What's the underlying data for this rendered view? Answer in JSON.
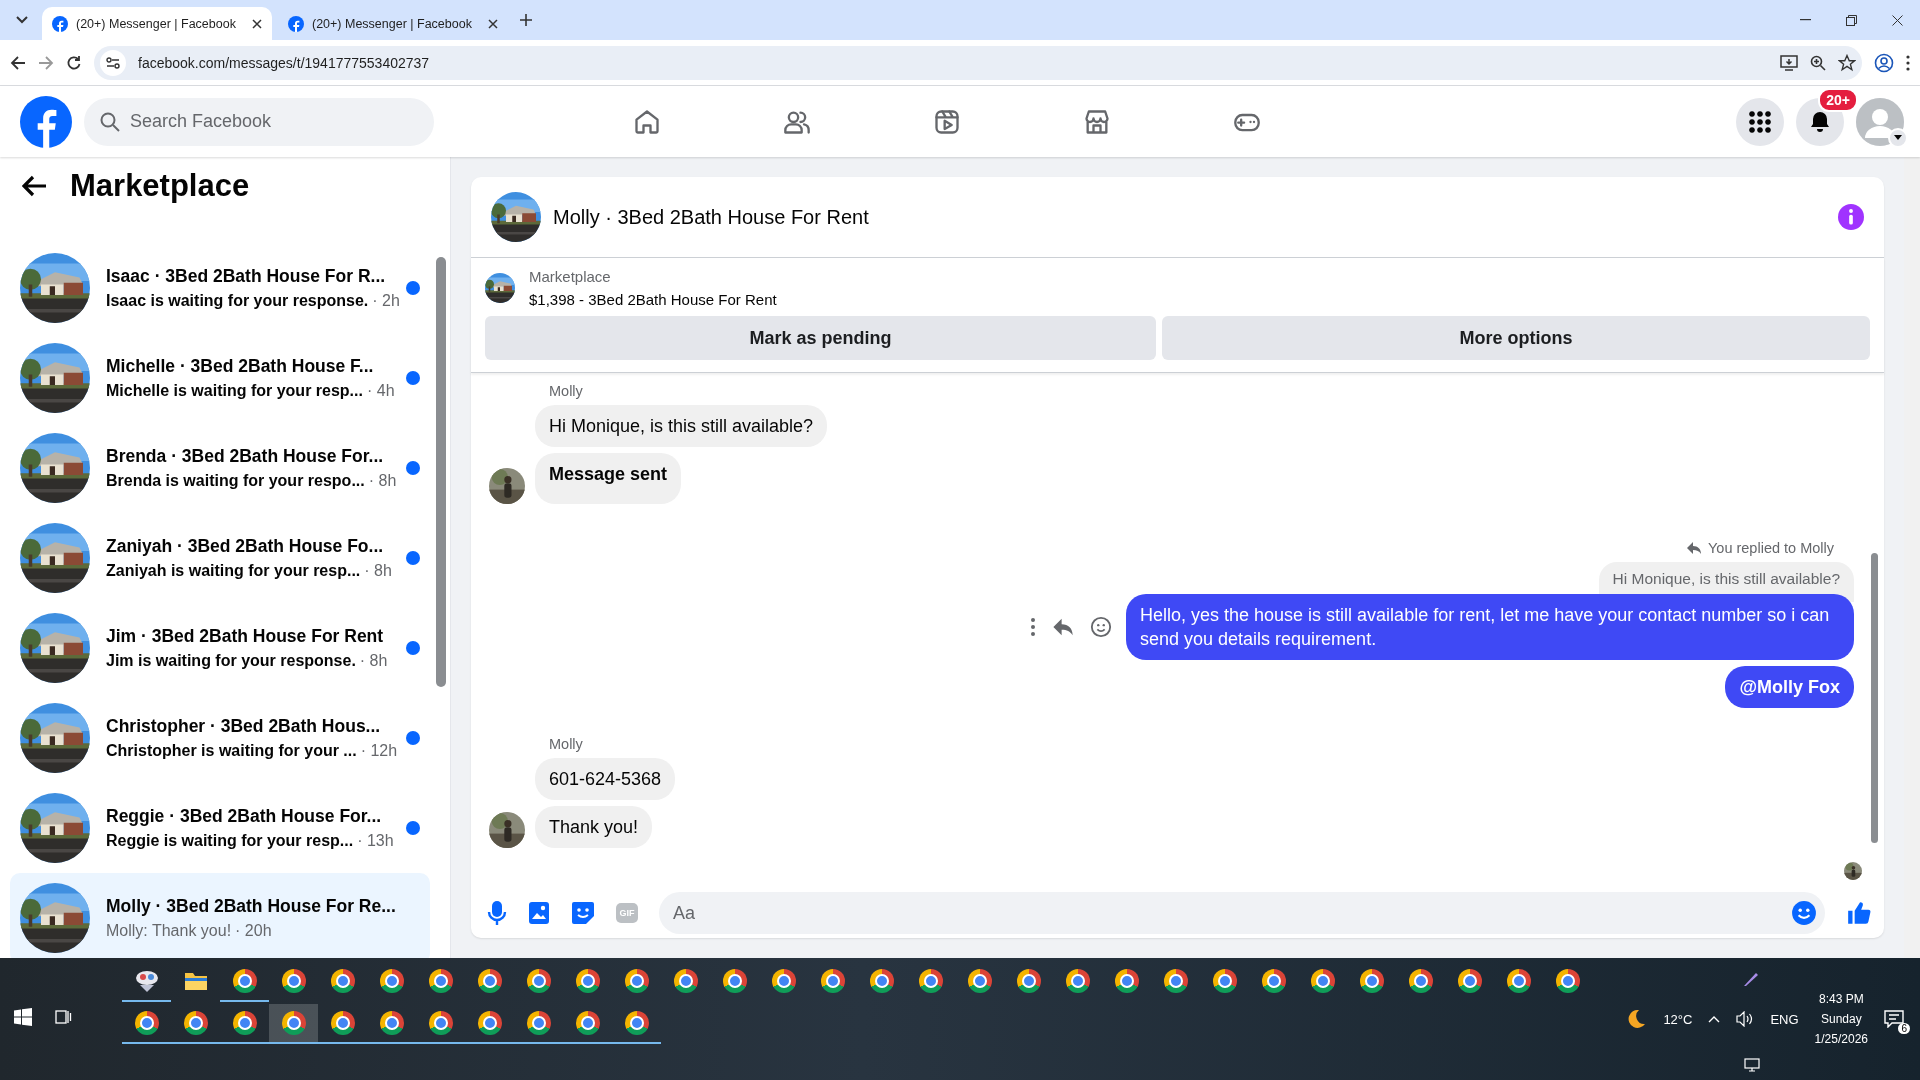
{
  "browser": {
    "tabs": [
      {
        "title": "(20+) Messenger | Facebook",
        "selected": true
      },
      {
        "title": "(20+) Messenger | Facebook",
        "selected": false
      }
    ],
    "url": "facebook.com/messages/t/1941777553402737"
  },
  "header": {
    "search_placeholder": "Search Facebook",
    "notification_badge": "20+"
  },
  "sidebar": {
    "title": "Marketplace",
    "conversations": [
      {
        "title": "Isaac · 3Bed 2Bath House For R...",
        "preview": "Isaac is waiting for your response.",
        "time": "· 2h",
        "unread": true,
        "selected": false
      },
      {
        "title": "Michelle · 3Bed 2Bath House F...",
        "preview": "Michelle is waiting for your resp...",
        "time": "· 4h",
        "unread": true,
        "selected": false
      },
      {
        "title": "Brenda · 3Bed 2Bath House For...",
        "preview": "Brenda is waiting for your respo...",
        "time": "· 8h",
        "unread": true,
        "selected": false
      },
      {
        "title": "Zaniyah · 3Bed 2Bath House Fo...",
        "preview": "Zaniyah is waiting for your resp...",
        "time": "· 8h",
        "unread": true,
        "selected": false
      },
      {
        "title": "Jim · 3Bed 2Bath House For Rent",
        "preview": "Jim is waiting for your response.",
        "time": "· 8h",
        "unread": true,
        "selected": false
      },
      {
        "title": "Christopher · 3Bed 2Bath Hous...",
        "preview": "Christopher is waiting for your ...",
        "time": "· 12h",
        "unread": true,
        "selected": false
      },
      {
        "title": "Reggie · 3Bed 2Bath House For...",
        "preview": "Reggie is waiting for your resp...",
        "time": "· 13h",
        "unread": true,
        "selected": false
      },
      {
        "title": "Molly · 3Bed 2Bath House For Re...",
        "preview": "Molly: Thank you!",
        "time": "· 20h",
        "unread": false,
        "selected": true
      }
    ]
  },
  "chat": {
    "title": "Molly · 3Bed 2Bath House For Rent",
    "listing": {
      "source": "Marketplace",
      "summary": "$1,398 - 3Bed 2Bath House For Rent",
      "buttons": [
        "Mark as pending",
        "More options"
      ]
    },
    "messages": [
      {
        "kind": "sender",
        "text": "Molly"
      },
      {
        "kind": "incoming",
        "text": "Hi Monique, is this still available?",
        "bold": false,
        "avatar": false
      },
      {
        "kind": "incoming",
        "text": "Message sent",
        "bold": true,
        "avatar": true
      },
      {
        "kind": "reply_note",
        "text": "You replied to Molly"
      },
      {
        "kind": "quote",
        "text": "Hi Monique, is this still available?"
      },
      {
        "kind": "outgoing",
        "text": "Hello, yes the house is still available for rent, let me have your contact number so i can send you details requirement.",
        "bold": false,
        "actions": true
      },
      {
        "kind": "outgoing",
        "text": "@Molly Fox",
        "bold": true,
        "actions": false
      },
      {
        "kind": "sender",
        "text": "Molly"
      },
      {
        "kind": "incoming",
        "text": "601-624-5368",
        "bold": false,
        "avatar": false
      },
      {
        "kind": "incoming",
        "text": "Thank you!",
        "bold": false,
        "avatar": true
      },
      {
        "kind": "seen"
      }
    ],
    "composer": {
      "placeholder": "Aa",
      "gif_label": "GIF"
    }
  },
  "taskbar": {
    "row1": [
      {
        "kind": "app",
        "running": true
      },
      {
        "kind": "folder",
        "running": false
      },
      {
        "kind": "browser",
        "running": true
      },
      {
        "kind": "browser",
        "running": false
      },
      {
        "kind": "browser",
        "running": false
      },
      {
        "kind": "browser",
        "running": false
      },
      {
        "kind": "browser",
        "running": false
      },
      {
        "kind": "browser",
        "running": false
      },
      {
        "kind": "browser",
        "running": false
      },
      {
        "kind": "browser",
        "running": false
      },
      {
        "kind": "browser",
        "running": false
      },
      {
        "kind": "browser",
        "running": false
      },
      {
        "kind": "browser",
        "running": false
      },
      {
        "kind": "browser",
        "running": false
      },
      {
        "kind": "browser",
        "running": false
      },
      {
        "kind": "browser",
        "running": false
      },
      {
        "kind": "browser",
        "running": false
      },
      {
        "kind": "browser",
        "running": false
      },
      {
        "kind": "browser",
        "running": false
      },
      {
        "kind": "browser",
        "running": false
      },
      {
        "kind": "browser",
        "running": false
      },
      {
        "kind": "browser",
        "running": false
      },
      {
        "kind": "browser",
        "running": false
      },
      {
        "kind": "browser",
        "running": false
      },
      {
        "kind": "browser",
        "running": false
      },
      {
        "kind": "browser",
        "running": false
      },
      {
        "kind": "browser",
        "running": false
      },
      {
        "kind": "browser",
        "running": false
      },
      {
        "kind": "browser",
        "running": false
      },
      {
        "kind": "browser",
        "running": false
      }
    ],
    "row2": [
      {
        "kind": "browser",
        "running": true
      },
      {
        "kind": "browser",
        "running": true
      },
      {
        "kind": "browser",
        "running": true
      },
      {
        "kind": "browser",
        "running": true,
        "selected": true
      },
      {
        "kind": "browser",
        "running": true
      },
      {
        "kind": "browser",
        "running": true
      },
      {
        "kind": "browser",
        "running": true
      },
      {
        "kind": "browser",
        "running": true
      },
      {
        "kind": "browser",
        "running": true
      },
      {
        "kind": "browser",
        "running": true
      },
      {
        "kind": "browser",
        "running": true
      }
    ],
    "weather": "12°C",
    "language": "ENG",
    "time": "8:43 PM",
    "day": "Sunday",
    "date": "1/25/2026",
    "notifications": "6"
  }
}
